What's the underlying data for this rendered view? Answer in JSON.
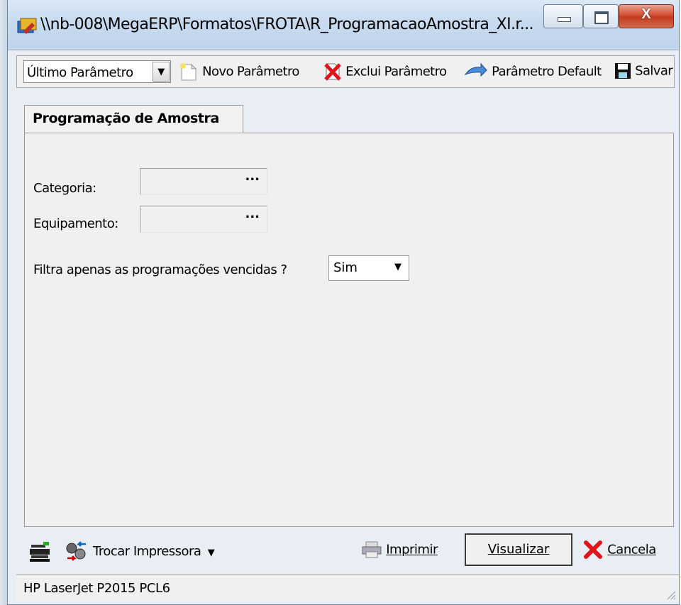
{
  "window": {
    "title": "\\\\nb-008\\MegaERP\\Formatos\\FROTA\\R_ProgramacaoAmostra_XI.r..."
  },
  "toolbar": {
    "param_select_value": "Último Parâmetro",
    "novo_label": "Novo Parâmetro",
    "exclui_label": "Exclui Parâmetro",
    "default_label": "Parâmetro Default",
    "salvar_label": "Salvar"
  },
  "tab": {
    "label": "Programação de Amostra"
  },
  "form": {
    "categoria_label": "Categoria:",
    "categoria_value": "",
    "equipamento_label": "Equipamento:",
    "equipamento_value": "",
    "lookup_button": "...",
    "filtra_label": "Filtra apenas as programações vencidas ?",
    "filtra_value": "Sim"
  },
  "bottom": {
    "trocar_label": "Trocar Impressora",
    "imprimir_label": "Imprimir",
    "visualizar_label": "Visualizar",
    "cancela_label": "Cancela"
  },
  "status": {
    "printer": "HP LaserJet P2015 PCL6"
  },
  "colors": {
    "titlebar": "#c7daef",
    "close_button": "#d0492b",
    "panel": "#f0f0f0"
  },
  "icons": {
    "app": "app-icon",
    "novo": "new-document-icon",
    "exclui": "delete-icon",
    "default": "arrow-icon",
    "salvar": "floppy-disk-icon",
    "config": "printer-settings-icon",
    "trocar": "swap-printer-icon",
    "imprimir": "printer-icon",
    "cancela": "red-x-icon"
  }
}
